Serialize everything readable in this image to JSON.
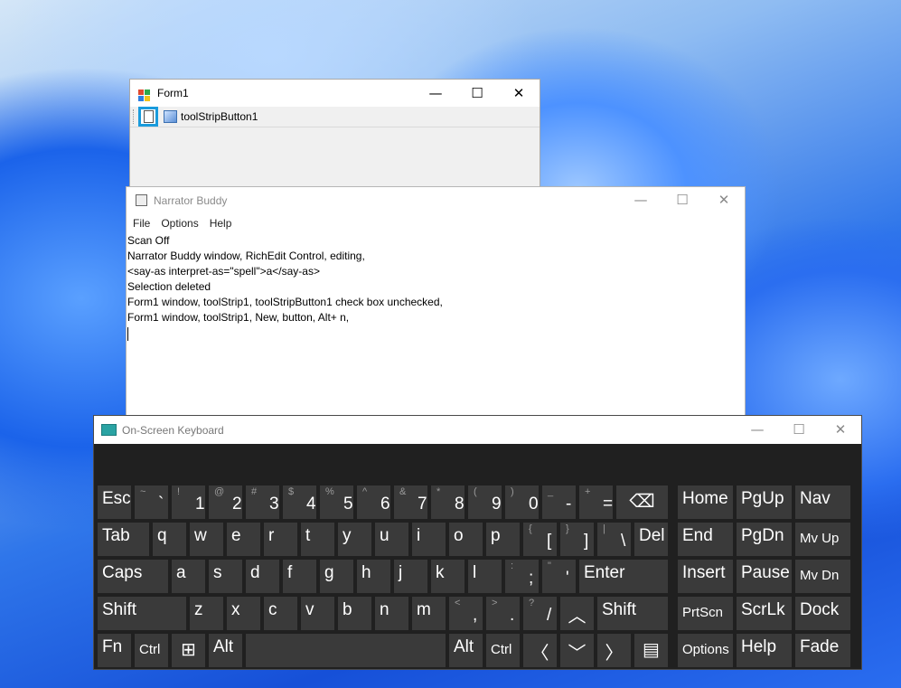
{
  "form1": {
    "title": "Form1",
    "toolstrip_button1_label": "toolStripButton1",
    "caption": {
      "minimize": "—",
      "maximize": "☐",
      "close": "✕"
    }
  },
  "narrator": {
    "title": "Narrator Buddy",
    "menu": [
      "File",
      "Options",
      "Help"
    ],
    "lines": [
      "Scan Off",
      "Narrator Buddy window, RichEdit Control, editing,",
      "<say-as interpret-as=\"spell\">a</say-as>",
      "Selection deleted",
      "Form1 window, toolStrip1, toolStripButton1 check box unchecked,",
      "Form1 window, toolStrip1, New, button, Alt+ n,"
    ],
    "caption": {
      "minimize": "—",
      "maximize": "☐",
      "close": "✕"
    }
  },
  "osk": {
    "title": "On-Screen Keyboard",
    "caption": {
      "minimize": "—",
      "maximize": "☐",
      "close": "✕"
    },
    "row1_digits": [
      {
        "shift": "~",
        "main": "`"
      },
      {
        "shift": "!",
        "main": "1"
      },
      {
        "shift": "@",
        "main": "2"
      },
      {
        "shift": "#",
        "main": "3"
      },
      {
        "shift": "$",
        "main": "4"
      },
      {
        "shift": "%",
        "main": "5"
      },
      {
        "shift": "^",
        "main": "6"
      },
      {
        "shift": "&",
        "main": "7"
      },
      {
        "shift": "*",
        "main": "8"
      },
      {
        "shift": "(",
        "main": "9"
      },
      {
        "shift": ")",
        "main": "0"
      },
      {
        "shift": "_",
        "main": "-"
      },
      {
        "shift": "+",
        "main": "="
      }
    ],
    "letters_row2": [
      "q",
      "w",
      "e",
      "r",
      "t",
      "y",
      "u",
      "i",
      "o",
      "p"
    ],
    "letters_row3": [
      "a",
      "s",
      "d",
      "f",
      "g",
      "h",
      "j",
      "k",
      "l"
    ],
    "letters_row4": [
      "z",
      "x",
      "c",
      "v",
      "b",
      "n",
      "m"
    ],
    "punct_row2": [
      {
        "shift": "{",
        "main": "["
      },
      {
        "shift": "}",
        "main": "]"
      },
      {
        "shift": "|",
        "main": "\\"
      }
    ],
    "punct_row3": [
      {
        "shift": ":",
        "main": ";"
      },
      {
        "shift": "\"",
        "main": "'"
      }
    ],
    "punct_row4": [
      {
        "shift": "<",
        "main": ","
      },
      {
        "shift": ">",
        "main": "."
      },
      {
        "shift": "?",
        "main": "/"
      }
    ],
    "keys": {
      "esc": "Esc",
      "tab": "Tab",
      "caps": "Caps",
      "shift": "Shift",
      "fn": "Fn",
      "ctrl": "Ctrl",
      "alt": "Alt",
      "del": "Del",
      "enter": "Enter",
      "home": "Home",
      "pgup": "PgUp",
      "nav": "Nav",
      "end": "End",
      "pgdn": "PgDn",
      "mvup": "Mv Up",
      "insert": "Insert",
      "pause": "Pause",
      "mvdn": "Mv Dn",
      "prtscn": "PrtScn",
      "scrlk": "ScrLk",
      "dock": "Dock",
      "options": "Options",
      "help": "Help",
      "fade": "Fade",
      "backspace_glyph": "⌫",
      "up_glyph": "︿",
      "down_glyph": "﹀",
      "left_glyph": "〈",
      "right_glyph": "〉",
      "win_glyph": "⊞",
      "menu_glyph": "▤"
    }
  }
}
